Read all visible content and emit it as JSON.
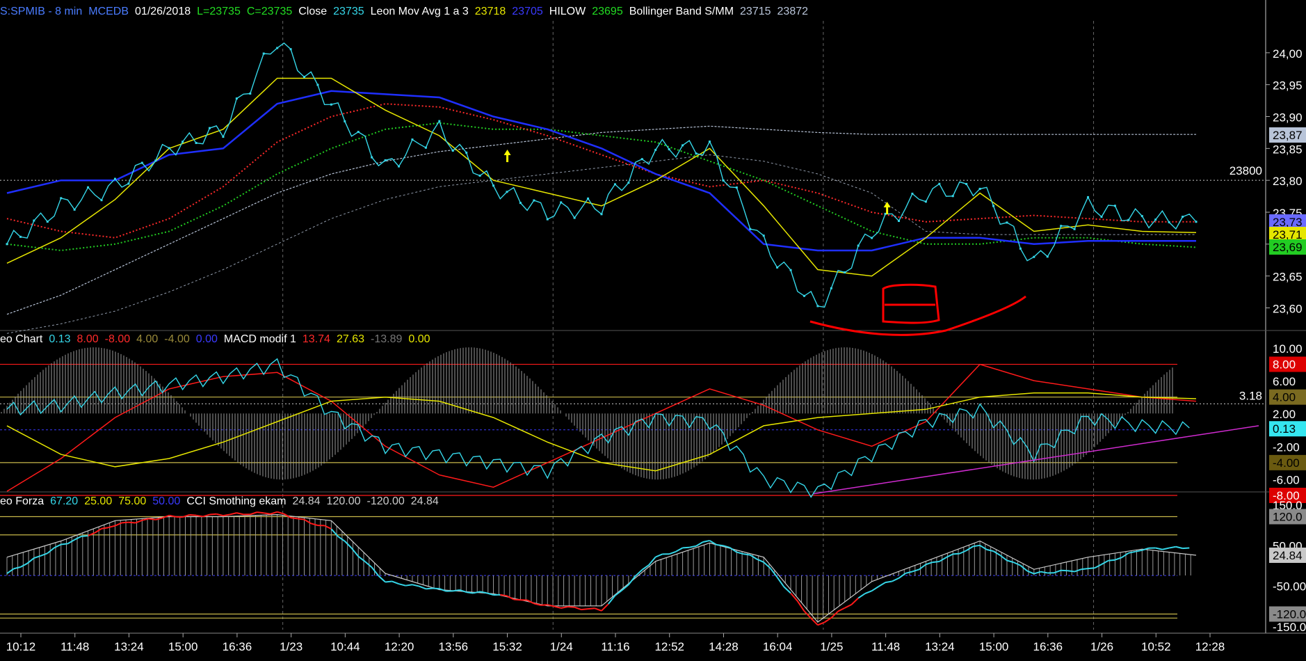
{
  "colors": {
    "background": "#000000",
    "grid": "#4a4a4a",
    "price": "#35d6e8",
    "blue_ma": "#1f2fff",
    "yellow": "#e6e600",
    "red_dotted": "#ff2a2a",
    "green_dotted": "#22cc22",
    "boll_line": "#b8c4d8",
    "label_text": "#ffffff",
    "red_line": "#ff1a1a",
    "magenta": "#d02bd0",
    "histogram": "#9a9a9a",
    "annotation": "#ff0000",
    "arrow": "#ffff00"
  },
  "price_panel": {
    "header": [
      {
        "text": "S:SPMIB - 8 min",
        "color": "#4a7cff"
      },
      {
        "text": "MCEDB",
        "color": "#4a7cff"
      },
      {
        "text": "01/26/2018",
        "color": "#ffffff"
      },
      {
        "text": "L=23735",
        "color": "#22dd22"
      },
      {
        "text": "C=23735",
        "color": "#22dd22"
      },
      {
        "text": "Close",
        "color": "#ffffff"
      },
      {
        "text": "23735",
        "color": "#35d6e8"
      },
      {
        "text": "Leon Mov Avg 1 a 3",
        "color": "#ffffff"
      },
      {
        "text": "23718",
        "color": "#e6e600"
      },
      {
        "text": "23705",
        "color": "#3a3aff"
      },
      {
        "text": "HILOW",
        "color": "#ffffff"
      },
      {
        "text": "23695",
        "color": "#22dd22"
      },
      {
        "text": "Bollinger Band S/MM",
        "color": "#ffffff"
      },
      {
        "text": "23715",
        "color": "#b8c4d8"
      },
      {
        "text": "23872",
        "color": "#b8c4d8"
      }
    ],
    "y_ticks": [
      "24,00",
      "23,95",
      "23,90",
      "23,85",
      "23,80",
      "23,75",
      "23,70",
      "23,65",
      "23,60"
    ],
    "reference_line_label": "23800",
    "value_boxes": [
      {
        "text": "23,87",
        "bg": "#b8c4d8",
        "fg": "#000000"
      },
      {
        "text": "23,73",
        "bg": "#6a6aff",
        "fg": "#000000"
      },
      {
        "text": "23,71",
        "bg": "#e6e600",
        "fg": "#000000"
      },
      {
        "text": "23,69",
        "bg": "#22cc22",
        "fg": "#000000"
      }
    ]
  },
  "macd_panel": {
    "header": [
      {
        "text": "eo Chart",
        "color": "#ffffff"
      },
      {
        "text": "0.13",
        "color": "#35d6e8"
      },
      {
        "text": "8.00",
        "color": "#ff2a2a"
      },
      {
        "text": "-8.00",
        "color": "#ff2a2a"
      },
      {
        "text": "4.00",
        "color": "#9a8a3a"
      },
      {
        "text": "-4.00",
        "color": "#9a8a3a"
      },
      {
        "text": "0.00",
        "color": "#3a3aff"
      },
      {
        "text": "MACD modif 1",
        "color": "#ffffff"
      },
      {
        "text": "13.74",
        "color": "#ff2a2a"
      },
      {
        "text": "27.63",
        "color": "#e6e600"
      },
      {
        "text": "-13.89",
        "color": "#777777"
      },
      {
        "text": "0.00",
        "color": "#e6e600"
      }
    ],
    "y_ticks": [
      "10.00",
      "6.00",
      "2.00",
      "-2.00",
      "-6.00"
    ],
    "reference_line_label": "3.18",
    "value_boxes": [
      {
        "text": "8.00",
        "bg": "#dd0000",
        "fg": "#ffffff"
      },
      {
        "text": "4.00",
        "bg": "#7a6a20",
        "fg": "#000000"
      },
      {
        "text": "0.13",
        "bg": "#35e6f0",
        "fg": "#000000"
      },
      {
        "text": "-4.00",
        "bg": "#6a5a10",
        "fg": "#000000"
      },
      {
        "text": "-8.00",
        "bg": "#dd0000",
        "fg": "#ffffff"
      }
    ]
  },
  "cci_panel": {
    "header": [
      {
        "text": "eo Forza",
        "color": "#ffffff"
      },
      {
        "text": "67.20",
        "color": "#35d6e8"
      },
      {
        "text": "25.00",
        "color": "#e6e600"
      },
      {
        "text": "75.00",
        "color": "#e6e600"
      },
      {
        "text": "50.00",
        "color": "#3a3aff"
      },
      {
        "text": "CCI Smothing ekam",
        "color": "#ffffff"
      },
      {
        "text": "24.84",
        "color": "#cccccc"
      },
      {
        "text": "120.00",
        "color": "#cccccc"
      },
      {
        "text": "-120.00",
        "color": "#cccccc"
      },
      {
        "text": "24.84",
        "color": "#cccccc"
      }
    ],
    "y_ticks": [
      "150.0",
      "50.00",
      "-50.00",
      "-150.0"
    ],
    "value_boxes": [
      {
        "text": "120.0",
        "bg": "#8a8a8a",
        "fg": "#000000"
      },
      {
        "text": "24.84",
        "bg": "#c8c8c8",
        "fg": "#000000"
      },
      {
        "text": "-120.0",
        "bg": "#8a8a8a",
        "fg": "#000000"
      }
    ]
  },
  "time_axis": [
    "10:12",
    "11:48",
    "13:24",
    "15:00",
    "16:36",
    "1/23",
    "10:44",
    "12:20",
    "13:56",
    "15:32",
    "1/24",
    "11:16",
    "12:52",
    "14:28",
    "16:04",
    "1/25",
    "11:48",
    "13:24",
    "15:00",
    "16:36",
    "1/26",
    "10:52",
    "12:28"
  ],
  "chart_data": {
    "type": "line",
    "title": "S:SPMIB - 8 min",
    "x": [
      "10:12",
      "11:48",
      "13:24",
      "15:00",
      "16:36",
      "1/23",
      "10:44",
      "12:20",
      "13:56",
      "15:32",
      "1/24",
      "11:16",
      "12:52",
      "14:28",
      "16:04",
      "1/25",
      "11:48",
      "13:24",
      "15:00",
      "16:36",
      "1/26",
      "10:52",
      "12:28"
    ],
    "price_ylim": [
      23570,
      24050
    ],
    "price_reference_line": 23800,
    "series": [
      {
        "name": "Close",
        "values": [
          23700,
          23760,
          23790,
          23850,
          23880,
          24020,
          23920,
          23820,
          23880,
          23790,
          23750,
          23760,
          23850,
          23850,
          23700,
          23600,
          23720,
          23780,
          23790,
          23670,
          23760,
          23740,
          23735
        ]
      },
      {
        "name": "Leon Mov Avg 1 a 3",
        "values": [
          23670,
          23710,
          23770,
          23850,
          23880,
          23960,
          23960,
          23910,
          23870,
          23800,
          23780,
          23760,
          23800,
          23850,
          23760,
          23660,
          23650,
          23710,
          23780,
          23720,
          23730,
          23720,
          23718
        ]
      },
      {
        "name": "23705",
        "values": [
          23780,
          23800,
          23800,
          23840,
          23850,
          23920,
          23940,
          23935,
          23930,
          23900,
          23880,
          23850,
          23810,
          23780,
          23700,
          23690,
          23690,
          23710,
          23710,
          23700,
          23705,
          23705,
          23705
        ]
      },
      {
        "name": "HILOW",
        "values": [
          23700,
          23690,
          23700,
          23720,
          23760,
          23810,
          23850,
          23880,
          23890,
          23880,
          23880,
          23870,
          23860,
          23830,
          23800,
          23760,
          23720,
          23700,
          23700,
          23710,
          23710,
          23700,
          23695
        ]
      }
    ],
    "bollinger_band": {
      "lower_end": 23715,
      "upper_end": 23872
    },
    "macd": {
      "ylim": [
        -8,
        10
      ],
      "reference_line": 3.18,
      "levels": {
        "upper": 8.0,
        "mid_upper": 4.0,
        "zero": 0.0,
        "mid_lower": -4.0,
        "lower": -8.0
      },
      "series": [
        {
          "name": "0.13",
          "values": [
            2.5,
            3.0,
            4.5,
            5.5,
            6.5,
            8.0,
            2.0,
            -2.0,
            -3.0,
            -4.0,
            -5.0,
            -1.0,
            1.5,
            1.0,
            -6.0,
            -7.5,
            -3.0,
            1.0,
            2.5,
            -3.0,
            1.5,
            0.5,
            0.13
          ]
        },
        {
          "name": "13.74",
          "values": [
            -7.5,
            -3.5,
            1.5,
            5.0,
            6.5,
            7.0,
            3.5,
            -2.0,
            -5.5,
            -7.0,
            -4.0,
            -1.0,
            2.0,
            5.0,
            3.0,
            0.0,
            -2.0,
            1.0,
            8.0,
            6.0,
            5.0,
            4.0,
            3.5
          ]
        },
        {
          "name": "27.63",
          "values": [
            0.5,
            -3.0,
            -4.5,
            -3.5,
            -1.5,
            1.0,
            3.5,
            4.0,
            3.5,
            1.5,
            -1.5,
            -4.0,
            -5.0,
            -3.0,
            0.5,
            1.5,
            2.0,
            2.5,
            4.0,
            4.5,
            4.5,
            4.0,
            3.8
          ]
        }
      ],
      "trendline": {
        "from": [
          -7.8
        ],
        "to": [
          0.5
        ]
      }
    },
    "cci": {
      "ylim": [
        -150,
        150
      ],
      "levels": {
        "upper": 120.0,
        "mid_upper": 75.0,
        "mid_lower": -120.0
      },
      "series": [
        {
          "name": "67.20",
          "values": [
            -20,
            50,
            100,
            120,
            125,
            130,
            90,
            -40,
            -60,
            -70,
            -100,
            -110,
            20,
            60,
            10,
            -150,
            -60,
            0,
            50,
            -20,
            -10,
            40,
            45
          ]
        },
        {
          "name": "24.84",
          "values": [
            20,
            60,
            110,
            120,
            120,
            125,
            110,
            -20,
            -60,
            -70,
            -100,
            -100,
            10,
            55,
            20,
            -140,
            -40,
            10,
            60,
            -10,
            20,
            40,
            24.84
          ]
        }
      ]
    }
  }
}
